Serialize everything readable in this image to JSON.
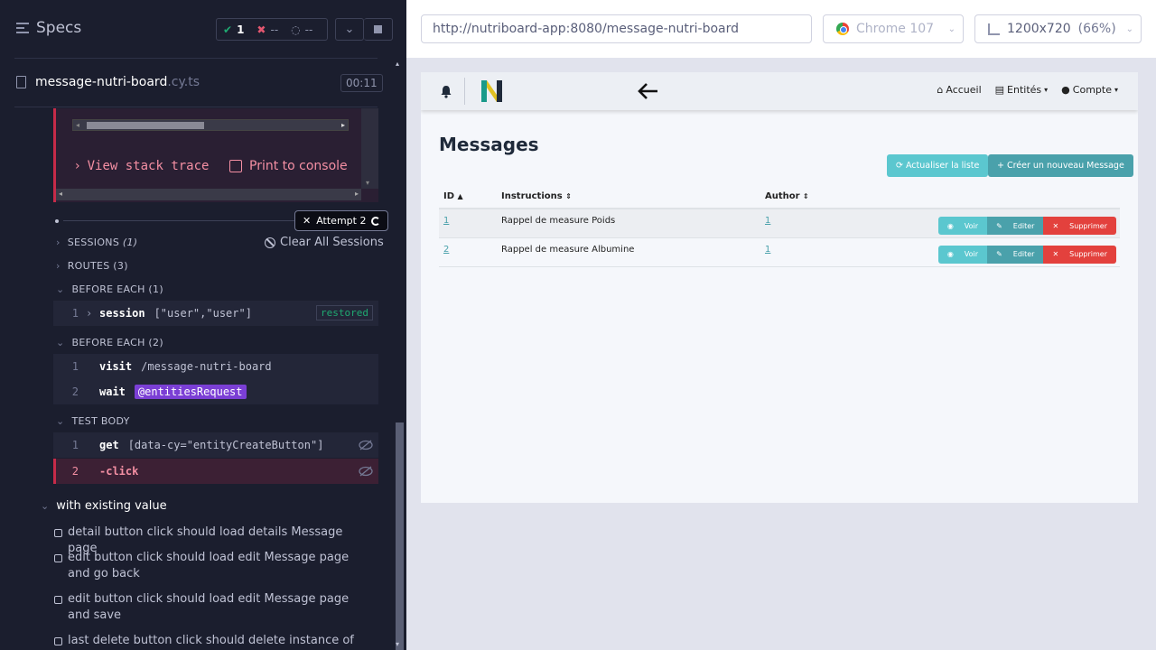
{
  "runner": {
    "specs_title": "Specs",
    "passed": "1",
    "failed": "--",
    "pending": "--",
    "spec_name": "message-nutri-board",
    "spec_ext": ".cy.ts",
    "timer": "00:11",
    "view_stack_trace": "View stack trace",
    "print_to_console": "Print to console",
    "attempt": "Attempt 2",
    "sessions_label": "SESSIONS",
    "sessions_count": "(1)",
    "clear_sessions": "Clear All Sessions",
    "routes_label": "ROUTES (3)",
    "before_each_1": "BEFORE EACH (1)",
    "before_each_2": "BEFORE EACH (2)",
    "test_body": "TEST BODY",
    "session_cmd": {
      "n": "1",
      "name": "session",
      "args": "[\"user\",\"user\"]",
      "badge": "restored"
    },
    "visit_cmd": {
      "n": "1",
      "name": "visit",
      "args": "/message-nutri-board"
    },
    "wait_cmd": {
      "n": "2",
      "name": "wait",
      "alias": "@entitiesRequest"
    },
    "get_cmd": {
      "n": "1",
      "name": "get",
      "args": "[data-cy=\"entityCreateButton\"]"
    },
    "click_cmd": {
      "n": "2",
      "name": "-click"
    },
    "suite": "with existing value",
    "tests": [
      "detail button click should load details Message page",
      "edit button click should load edit Message page and go back",
      "edit button click should load edit Message page and save",
      "last delete button click should delete instance of"
    ]
  },
  "browser": {
    "url": "http://nutriboard-app:8080/message-nutri-board",
    "name": "Chrome 107",
    "viewport": "1200x720",
    "zoom": "(66%)"
  },
  "app": {
    "nav": {
      "home": "Accueil",
      "entities": "Entités",
      "account": "Compte"
    },
    "title": "Messages",
    "refresh_button": "Actualiser la liste",
    "create_button": "Créer un nouveau Message",
    "columns": [
      "ID",
      "Instructions",
      "Author"
    ],
    "rows": [
      {
        "id": "1",
        "instructions": "Rappel de measure Poids",
        "author": "1"
      },
      {
        "id": "2",
        "instructions": "Rappel de measure Albumine",
        "author": "1"
      }
    ],
    "actions": {
      "view": "Voir",
      "edit": "Editer",
      "delete": "Supprimer"
    }
  },
  "colors": {
    "fail": "#c62b49",
    "pass": "#1fa971",
    "accent": "#4aa1ab",
    "danger": "#e3413d"
  }
}
